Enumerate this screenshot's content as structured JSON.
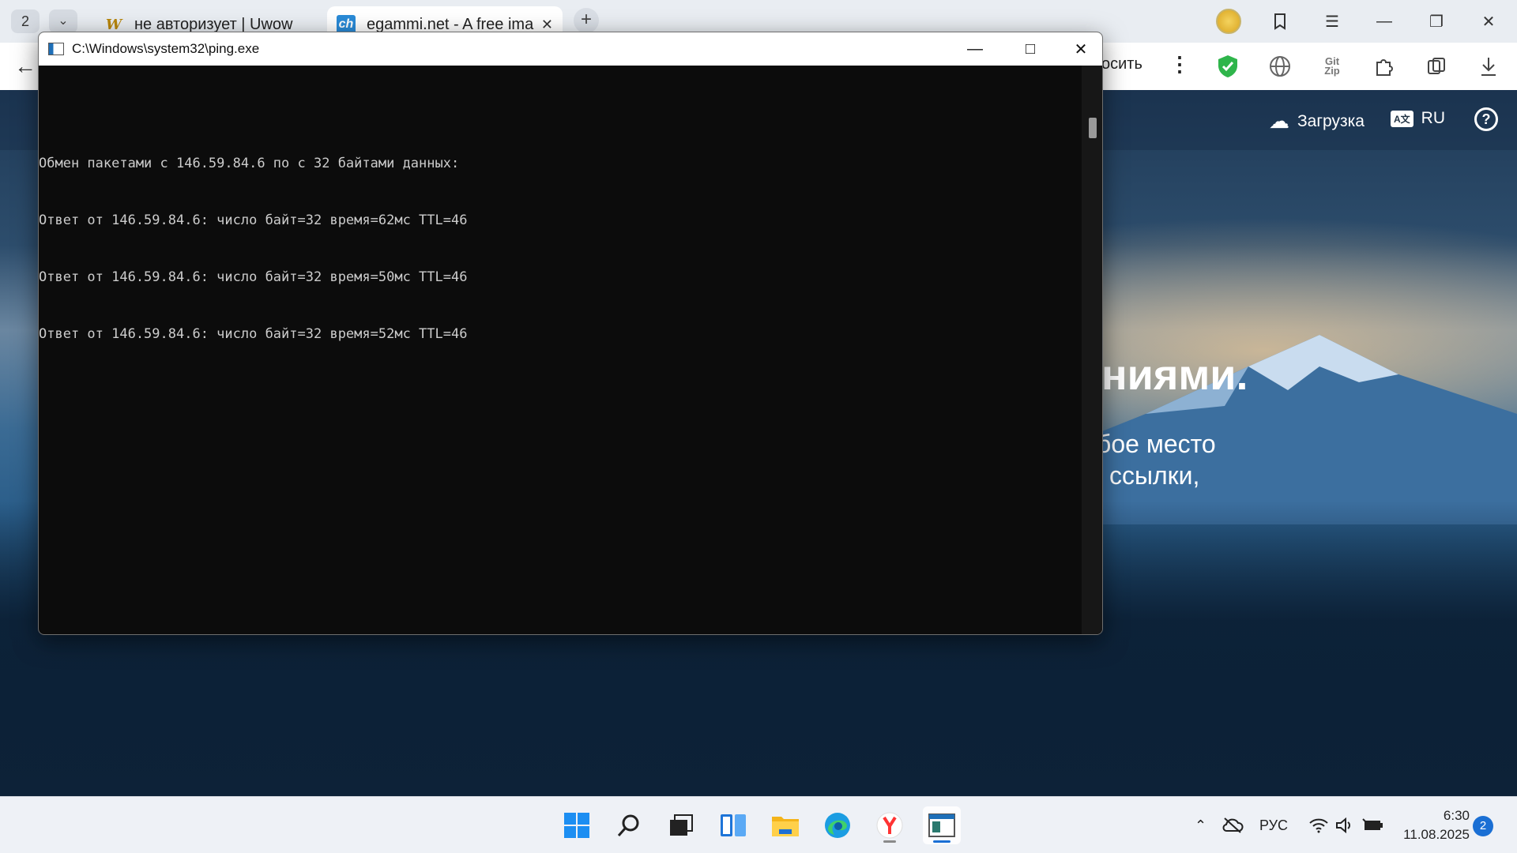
{
  "browser": {
    "tab_count": "2",
    "tabs": [
      {
        "title": "не авторизует | Uwow",
        "favicon": "W"
      },
      {
        "title": "egammi.net - A free ima",
        "favicon": "ch"
      }
    ],
    "toolbar_partial_text": "осить"
  },
  "page": {
    "header": {
      "upload_label": "Загрузка",
      "lang_label": "RU",
      "help_label": "?"
    },
    "hero_title_partial": "ниями.",
    "hero_line1_partial": "бое место",
    "hero_line2_partial": "ссылки,"
  },
  "console": {
    "title": "C:\\Windows\\system32\\ping.exe",
    "lines": [
      "Обмен пакетами с 146.59.84.6 по с 32 байтами данных:",
      "Ответ от 146.59.84.6: число байт=32 время=62мс TTL=46",
      "Ответ от 146.59.84.6: число байт=32 время=50мс TTL=46",
      "Ответ от 146.59.84.6: число байт=32 время=52мс TTL=46"
    ]
  },
  "taskbar": {
    "apps": [
      "start-icon",
      "search-icon",
      "task-view-icon",
      "widgets-icon",
      "file-explorer-icon",
      "edge-icon",
      "yandex-browser-icon",
      "console-icon"
    ],
    "language": "РУС",
    "time": "6:30",
    "date": "11.08.2025",
    "notifications": "2"
  },
  "colors": {
    "console_bg": "#0c0c0c",
    "console_text": "#cccccc",
    "accent": "#1a6fd4",
    "shield_green": "#2fb54b"
  }
}
